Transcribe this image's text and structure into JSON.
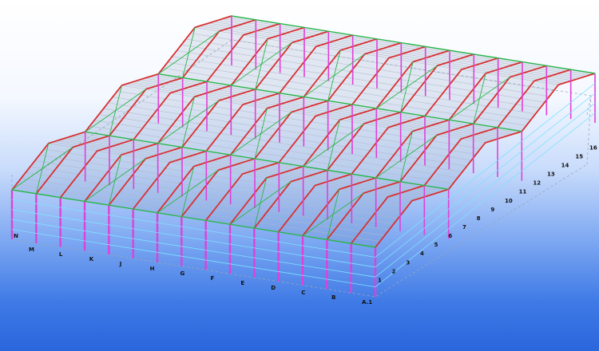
{
  "model": {
    "colors": {
      "column": "#e040d8",
      "rafter": "#d83030",
      "brace": "#2cb54a",
      "purlin": "#b0b8c8",
      "girt": "#7fe0ff",
      "roof_tint": "#7a8fb8"
    },
    "front_labels": [
      "M",
      "L",
      "K",
      "J",
      "H",
      "G",
      "F",
      "E",
      "D",
      "C",
      "B",
      "A.1"
    ],
    "side_labels": [
      "1",
      "2",
      "3",
      "4",
      "5",
      "6",
      "7",
      "8",
      "9",
      "10",
      "11",
      "12",
      "13",
      "14",
      "15",
      "16"
    ],
    "corner_label": "N"
  }
}
